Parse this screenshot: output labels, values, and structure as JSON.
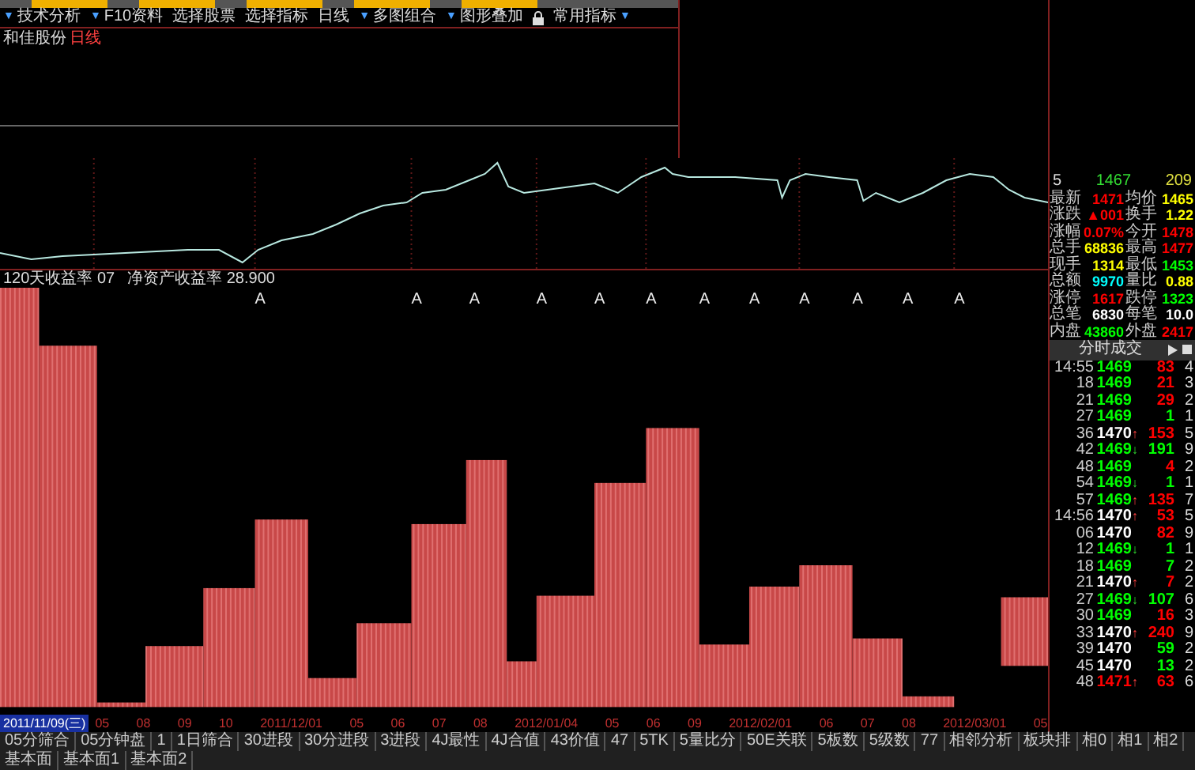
{
  "toolbar": [
    {
      "caret": "▼",
      "label": "技术分析"
    },
    {
      "caret": "▼",
      "label": "F10资料"
    },
    {
      "label": "选择股票"
    },
    {
      "label": "选择指标"
    },
    {
      "label": "日线"
    },
    {
      "caret": "▼",
      "label": "多图组合"
    },
    {
      "caret": "▼",
      "label": "图形叠加"
    },
    {
      "lock": true,
      "label": "常用指标",
      "caret_after": "▼"
    }
  ],
  "chart_title": {
    "stock": "和佳股份",
    "period": "日线"
  },
  "indicator_row": [
    "120天收益率 07",
    "净资产收益率 28.900"
  ],
  "event_marks": [
    "A",
    "A",
    "A",
    "A",
    "A",
    "A",
    "A",
    "A",
    "A",
    "A",
    "A",
    "A"
  ],
  "date_axis": {
    "current": "2011/11/09(三)",
    "labels": [
      "05",
      "08",
      "09",
      "10",
      "2011/12/01",
      "05",
      "06",
      "07",
      "08",
      "2012/01/04",
      "05",
      "06",
      "09",
      "2012/02/01",
      "06",
      "07",
      "08",
      "2012/03/01",
      "05"
    ]
  },
  "quote_header": [
    "5",
    "1467",
    "209"
  ],
  "quote_rows": [
    {
      "cells": [
        {
          "label": "最新",
          "value": {
            "text": "1471",
            "color": "#ff0000"
          }
        },
        {
          "label": "均价",
          "value": {
            "text": "1465",
            "color": "#ffff00"
          }
        }
      ]
    },
    {
      "cells": [
        {
          "label": "涨跌",
          "value": {
            "text": "▲001",
            "color": "#ff0000"
          }
        },
        {
          "label": "换手",
          "value": {
            "text": "1.22",
            "color": "#ffff00"
          }
        }
      ]
    },
    {
      "cells": [
        {
          "label": "涨幅",
          "value": {
            "text": "0.07%",
            "color": "#ff0000"
          }
        },
        {
          "label": "今开",
          "value": {
            "text": "1478",
            "color": "#ff0000"
          }
        }
      ]
    },
    {
      "cells": [
        {
          "label": "总手",
          "value": {
            "text": "68836",
            "color": "#ffff00"
          }
        },
        {
          "label": "最高",
          "value": {
            "text": "1477",
            "color": "#ff0000"
          }
        }
      ]
    },
    {
      "cells": [
        {
          "label": "现手",
          "value": {
            "text": "1314",
            "color": "#ffff00"
          }
        },
        {
          "label": "最低",
          "value": {
            "text": "1453",
            "color": "#00ff00"
          }
        }
      ]
    },
    {
      "cells": [
        {
          "label": "总额",
          "value": {
            "text": "9970",
            "color": "#00ffff"
          }
        },
        {
          "label": "量比",
          "value": {
            "text": "0.88",
            "color": "#ffff00"
          }
        }
      ]
    },
    {
      "cells": [
        {
          "label": "涨停",
          "value": {
            "text": "1617",
            "color": "#ff0000"
          }
        },
        {
          "label": "跌停",
          "value": {
            "text": "1323",
            "color": "#00ff00"
          }
        }
      ]
    },
    {
      "cells": [
        {
          "label": "总笔",
          "value": {
            "text": "6830",
            "color": "#ffffff"
          }
        },
        {
          "label": "每笔",
          "value": {
            "text": "10.0",
            "color": "#ffffff"
          }
        }
      ]
    },
    {
      "cells": [
        {
          "label": "内盘",
          "value": {
            "text": "43860",
            "color": "#00ff00"
          }
        },
        {
          "label": "外盘",
          "value": {
            "text": "2417",
            "color": "#ff0000"
          }
        }
      ]
    }
  ],
  "trades_title": "分时成交",
  "trades": [
    {
      "time": "14:55",
      "price": {
        "text": "1469",
        "color": "#00ff00"
      },
      "volume": {
        "text": "83",
        "color": "#ff0000"
      },
      "count": "4"
    },
    {
      "time": "18",
      "price": {
        "text": "1469",
        "color": "#00ff00"
      },
      "volume": {
        "text": "21",
        "color": "#ff0000"
      },
      "count": "3"
    },
    {
      "time": "21",
      "price": {
        "text": "1469",
        "color": "#00ff00"
      },
      "volume": {
        "text": "29",
        "color": "#ff0000"
      },
      "count": "2"
    },
    {
      "time": "27",
      "price": {
        "text": "1469",
        "color": "#00ff00"
      },
      "volume": {
        "text": "1",
        "color": "#00ff00"
      },
      "count": "1"
    },
    {
      "time": "36",
      "price": {
        "text": "1470",
        "color": "#ffffff"
      },
      "arrow": "↑",
      "volume": {
        "text": "153",
        "color": "#ff0000"
      },
      "count": "5"
    },
    {
      "time": "42",
      "price": {
        "text": "1469",
        "color": "#00ff00"
      },
      "arrow": "↓",
      "volume": {
        "text": "191",
        "color": "#00ff00"
      },
      "count": "9"
    },
    {
      "time": "48",
      "price": {
        "text": "1469",
        "color": "#00ff00"
      },
      "volume": {
        "text": "4",
        "color": "#ff0000"
      },
      "count": "2"
    },
    {
      "time": "54",
      "price": {
        "text": "1469",
        "color": "#00ff00"
      },
      "arrow": "↓",
      "volume": {
        "text": "1",
        "color": "#00ff00"
      },
      "count": "1"
    },
    {
      "time": "57",
      "price": {
        "text": "1469",
        "color": "#00ff00"
      },
      "arrow": "↑",
      "volume": {
        "text": "135",
        "color": "#ff0000"
      },
      "count": "7"
    },
    {
      "time": "14:56",
      "price": {
        "text": "1470",
        "color": "#ffffff"
      },
      "arrow": "↑",
      "volume": {
        "text": "53",
        "color": "#ff0000"
      },
      "count": "5"
    },
    {
      "time": "06",
      "price": {
        "text": "1470",
        "color": "#ffffff"
      },
      "volume": {
        "text": "82",
        "color": "#ff0000"
      },
      "count": "9"
    },
    {
      "time": "12",
      "price": {
        "text": "1469",
        "color": "#00ff00"
      },
      "arrow": "↓",
      "volume": {
        "text": "1",
        "color": "#00ff00"
      },
      "count": "1"
    },
    {
      "time": "18",
      "price": {
        "text": "1469",
        "color": "#00ff00"
      },
      "volume": {
        "text": "7",
        "color": "#00ff00"
      },
      "count": "2"
    },
    {
      "time": "21",
      "price": {
        "text": "1470",
        "color": "#ffffff"
      },
      "arrow": "↑",
      "volume": {
        "text": "7",
        "color": "#ff0000"
      },
      "count": "2"
    },
    {
      "time": "27",
      "price": {
        "text": "1469",
        "color": "#00ff00"
      },
      "arrow": "↓",
      "volume": {
        "text": "107",
        "color": "#00ff00"
      },
      "count": "6"
    },
    {
      "time": "30",
      "price": {
        "text": "1469",
        "color": "#00ff00"
      },
      "volume": {
        "text": "16",
        "color": "#ff0000"
      },
      "count": "3"
    },
    {
      "time": "33",
      "price": {
        "text": "1470",
        "color": "#ffffff"
      },
      "arrow": "↑",
      "volume": {
        "text": "240",
        "color": "#ff0000"
      },
      "count": "9"
    },
    {
      "time": "39",
      "price": {
        "text": "1470",
        "color": "#ffffff"
      },
      "volume": {
        "text": "59",
        "color": "#00ff00"
      },
      "count": "2"
    },
    {
      "time": "45",
      "price": {
        "text": "1470",
        "color": "#ffffff"
      },
      "volume": {
        "text": "13",
        "color": "#00ff00"
      },
      "count": "2"
    },
    {
      "time": "48",
      "price": {
        "text": "1471",
        "color": "#ff0000"
      },
      "arrow": "↑",
      "volume": {
        "text": "63",
        "color": "#ff0000"
      },
      "count": "6"
    }
  ],
  "bottom_tabs": [
    "05分筛合",
    "05分钟盘",
    "1",
    "1日筛合",
    "30进段",
    "30分进段",
    "3进段",
    "4J最性",
    "4J合值",
    "43价值",
    "47",
    "5TK",
    "5量比分",
    "50E关联",
    "5板数",
    "5级数",
    "77",
    "相邻分析",
    "板块排",
    "相0",
    "相1",
    "相2",
    "基本面",
    "基本面1",
    "基本面2"
  ]
}
